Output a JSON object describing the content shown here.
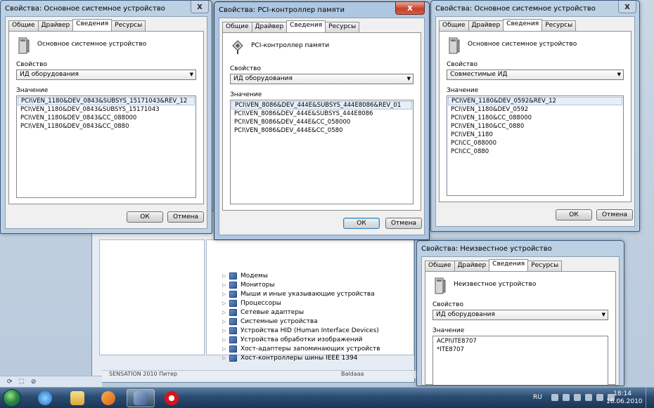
{
  "device_manager": {
    "tree_items": [
      {
        "label": "Модемы"
      },
      {
        "label": "Мониторы"
      },
      {
        "label": "Мыши и иные указывающие устройства"
      },
      {
        "label": "Процессоры"
      },
      {
        "label": "Сетевые адаптеры"
      },
      {
        "label": "Системные устройства"
      },
      {
        "label": "Устройства HID (Human Interface Devices)"
      },
      {
        "label": "Устройства обработки изображений"
      },
      {
        "label": "Хост-адаптеры запоминающих устройств"
      },
      {
        "label": "Хост-контроллеры шины IEEE 1394"
      }
    ],
    "status_left": "SENSATION 2010 Питер",
    "status_right": "Baldaaa"
  },
  "dialogs": {
    "left": {
      "title": "Свойства: Основное системное устройство",
      "tabs": [
        "Общие",
        "Драйвер",
        "Сведения",
        "Ресурсы"
      ],
      "selected_tab": "Сведения",
      "device_name": "Основное системное устройство",
      "property_label": "Свойство",
      "property_value": "ИД оборудования",
      "value_label": "Значение",
      "values": [
        "PCI\\VEN_1180&DEV_0843&SUBSYS_15171043&REV_12",
        "PCI\\VEN_1180&DEV_0843&SUBSYS_15171043",
        "PCI\\VEN_1180&DEV_0843&CC_088000",
        "PCI\\VEN_1180&DEV_0843&CC_0880"
      ],
      "ok": "ОК",
      "cancel": "Отмена",
      "close": "x"
    },
    "middle": {
      "title": "Свойства: PCI-контроллер памяти",
      "tabs": [
        "Общие",
        "Драйвер",
        "Сведения",
        "Ресурсы"
      ],
      "selected_tab": "Сведения",
      "device_name": "PCI-контроллер памяти",
      "property_label": "Свойство",
      "property_value": "ИД оборудования",
      "value_label": "Значение",
      "values": [
        "PCI\\VEN_8086&DEV_444E&SUBSYS_444E8086&REV_01",
        "PCI\\VEN_8086&DEV_444E&SUBSYS_444E8086",
        "PCI\\VEN_8086&DEV_444E&CC_058000",
        "PCI\\VEN_8086&DEV_444E&CC_0580"
      ],
      "ok": "ОК",
      "cancel": "Отмена",
      "close": "x"
    },
    "right": {
      "title": "Свойства: Основное системное устройство",
      "tabs": [
        "Общие",
        "Драйвер",
        "Сведения",
        "Ресурсы"
      ],
      "selected_tab": "Сведения",
      "device_name": "Основное системное устройство",
      "property_label": "Свойство",
      "property_value": "Совместимые ИД",
      "value_label": "Значение",
      "values": [
        "PCI\\VEN_1180&DEV_0592&REV_12",
        "PCI\\VEN_1180&DEV_0592",
        "PCI\\VEN_1180&CC_088000",
        "PCI\\VEN_1180&CC_0880",
        "PCI\\VEN_1180",
        "PCI\\CC_088000",
        "PCI\\CC_0880"
      ],
      "ok": "ОК",
      "cancel": "Отмена",
      "close": "x"
    },
    "bottom": {
      "title": "Свойства: Неизвестное устройство",
      "tabs": [
        "Общие",
        "Драйвер",
        "Сведения",
        "Ресурсы"
      ],
      "selected_tab": "Сведения",
      "device_name": "Неизвестное устройство",
      "property_label": "Свойство",
      "property_value": "ИД оборудования",
      "value_label": "Значение",
      "values": [
        "ACPI\\ITE8707",
        "*ITE8707"
      ]
    }
  },
  "taskbar": {
    "language": "RU",
    "time": "18:14",
    "date": "16.06.2010",
    "apps": [
      "start-orb",
      "internet-explorer",
      "windows-explorer",
      "media-player",
      "device-manager",
      "opera"
    ]
  }
}
